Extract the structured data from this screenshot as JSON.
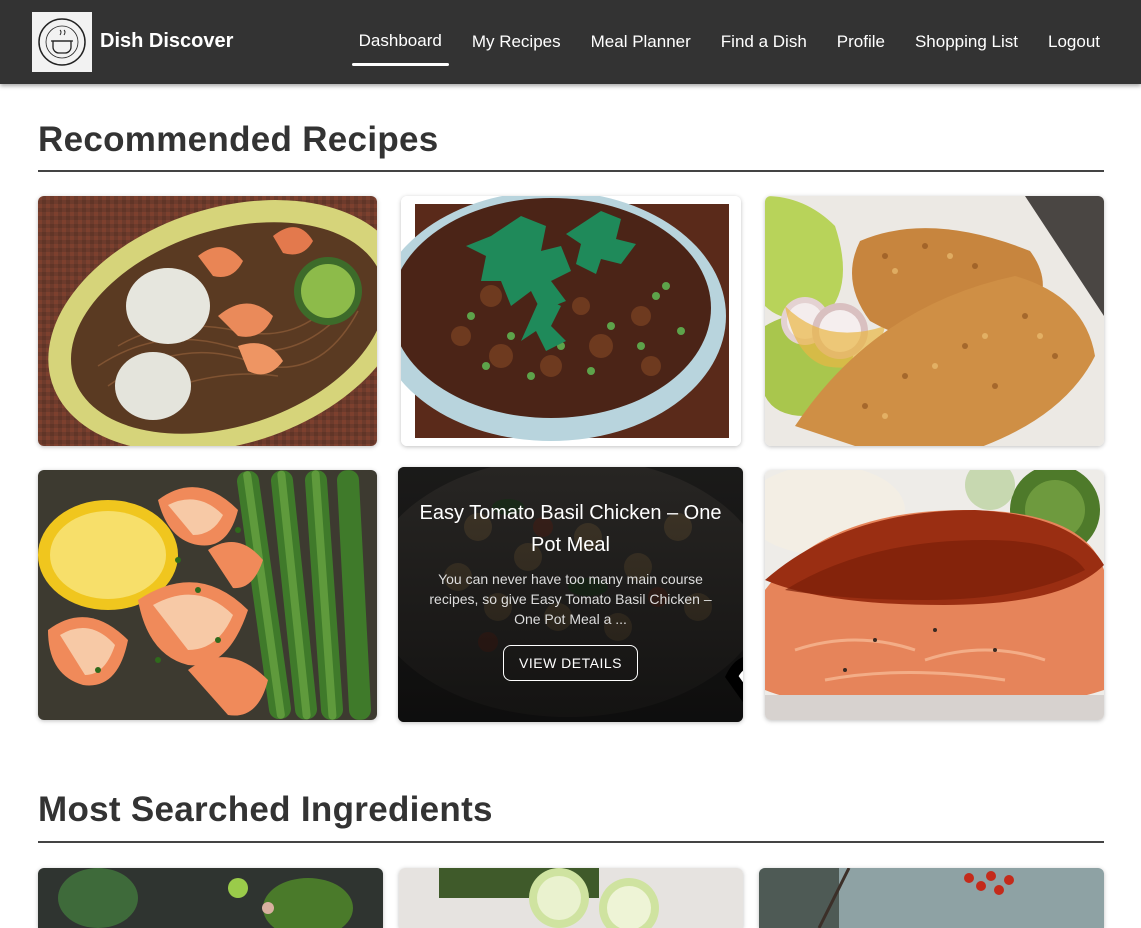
{
  "brand": {
    "logo_text": "DISH DISCOVER",
    "name": "Dish Discover"
  },
  "nav": {
    "items": [
      {
        "label": "Dashboard",
        "active": true
      },
      {
        "label": "My Recipes"
      },
      {
        "label": "Meal Planner"
      },
      {
        "label": "Find a Dish"
      },
      {
        "label": "Profile"
      },
      {
        "label": "Shopping List"
      },
      {
        "label": "Logout"
      }
    ]
  },
  "recommended": {
    "title": "Recommended Recipes",
    "cards": [
      {
        "image": "noodle-shrimp-dish"
      },
      {
        "image": "keema-peas-curry"
      },
      {
        "image": "crumbed-chicken-tenders"
      },
      {
        "image": "lemon-shrimp-asparagus"
      },
      {
        "image": "tomato-basil-pasta",
        "hovered": true,
        "title": "Easy Tomato Basil Chicken – One Pot Meal",
        "description": "You can never have too many main course recipes, so give Easy Tomato Basil Chicken – One Pot Meal a ...",
        "button": "VIEW DETAILS"
      },
      {
        "image": "glazed-salmon-fillet"
      }
    ]
  },
  "ingredients": {
    "title": "Most Searched Ingredients",
    "cards": [
      {
        "image": "herbs-and-greens"
      },
      {
        "image": "sliced-cucumber"
      },
      {
        "image": "red-berries-branch"
      }
    ]
  },
  "colors": {
    "navbar": "#333333",
    "text": "#333333",
    "accent": "#ffffff"
  }
}
